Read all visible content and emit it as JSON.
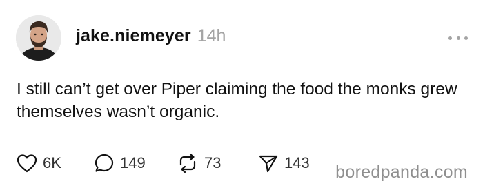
{
  "post": {
    "username": "jake.niemeyer",
    "timestamp": "14h",
    "text": "I still can’t get over Piper claiming the food the monks grew themselves wasn’t organic."
  },
  "actions": {
    "likes": "6K",
    "replies": "149",
    "reposts": "73",
    "shares": "143"
  },
  "icons": {
    "like": "heart-icon",
    "reply": "speech-bubble-icon",
    "repost": "repost-arrows-icon",
    "share": "paper-plane-icon",
    "more": "more-dots-icon"
  },
  "watermark": "boredpanda.com",
  "colors": {
    "text": "#111111",
    "muted": "#a4a4a4",
    "watermark": "#8f8f8f",
    "background": "#ffffff"
  }
}
